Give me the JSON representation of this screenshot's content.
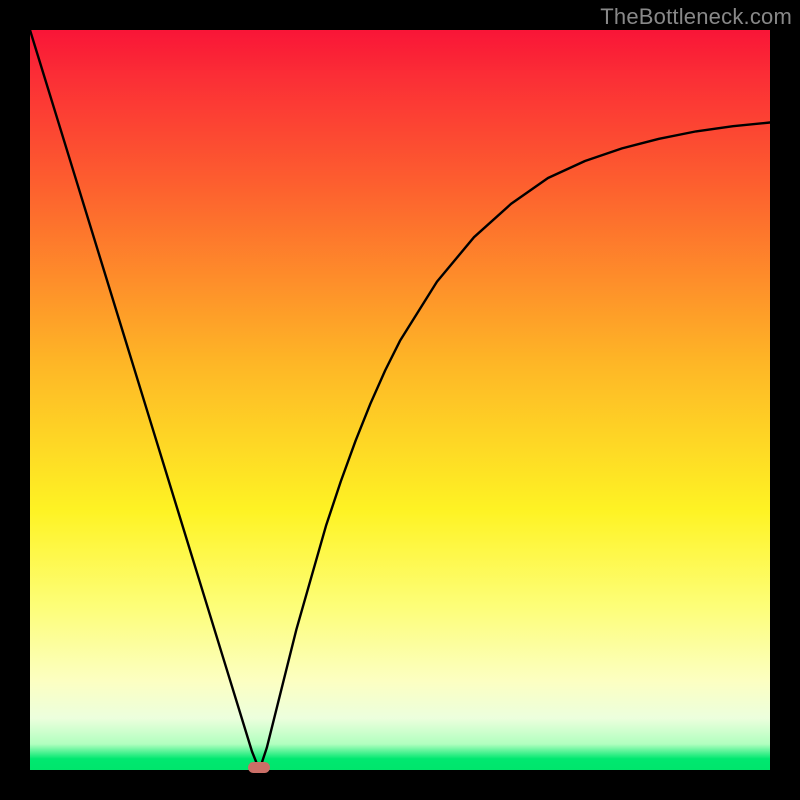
{
  "watermark": "TheBottleneck.com",
  "chart_data": {
    "type": "line",
    "title": "",
    "xlabel": "",
    "ylabel": "",
    "xlim": [
      0,
      100
    ],
    "ylim": [
      0,
      100
    ],
    "grid": false,
    "legend": false,
    "x": [
      0,
      2,
      4,
      6,
      8,
      10,
      12,
      14,
      16,
      18,
      20,
      22,
      24,
      26,
      28,
      30,
      31,
      32,
      34,
      36,
      38,
      40,
      42,
      44,
      46,
      48,
      50,
      55,
      60,
      65,
      70,
      75,
      80,
      85,
      90,
      95,
      100
    ],
    "values": [
      100,
      93.5,
      87,
      80.5,
      74,
      67.5,
      61,
      54.5,
      48,
      41.5,
      35,
      28.5,
      22,
      15.5,
      9,
      2.5,
      0,
      3,
      11,
      19,
      26,
      33,
      39,
      44.5,
      49.5,
      54,
      58,
      66,
      72,
      76.5,
      80,
      82.3,
      84,
      85.3,
      86.3,
      87,
      87.5
    ],
    "annotations": [
      {
        "kind": "marker",
        "x": 31,
        "y": 0,
        "shape": "pill",
        "color": "#cb6f67"
      }
    ],
    "background": {
      "type": "vertical-gradient",
      "stops": [
        {
          "pos": 0,
          "color": "#f91537"
        },
        {
          "pos": 45,
          "color": "#feb626"
        },
        {
          "pos": 78,
          "color": "#fdfe79"
        },
        {
          "pos": 98,
          "color": "#00e870"
        },
        {
          "pos": 100,
          "color": "#00e56c"
        }
      ]
    }
  }
}
